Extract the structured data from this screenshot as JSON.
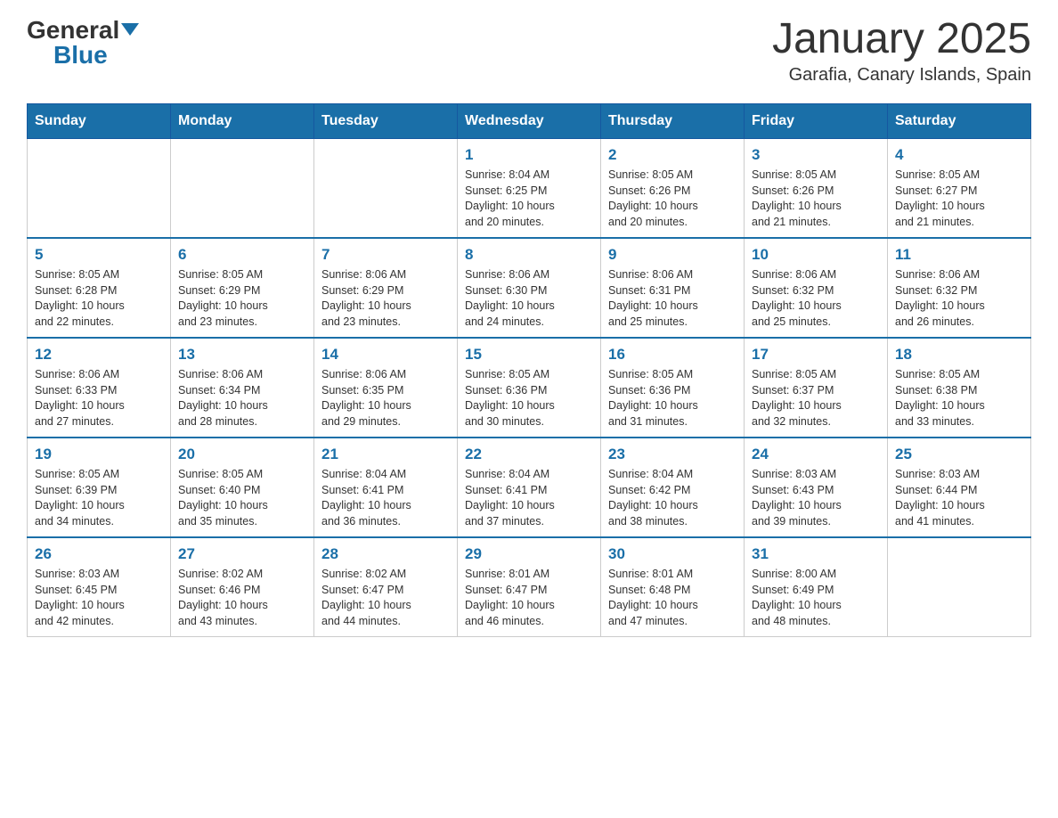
{
  "header": {
    "logo_general": "General",
    "logo_blue": "Blue",
    "month_title": "January 2025",
    "location": "Garafia, Canary Islands, Spain"
  },
  "days_of_week": [
    "Sunday",
    "Monday",
    "Tuesday",
    "Wednesday",
    "Thursday",
    "Friday",
    "Saturday"
  ],
  "weeks": [
    [
      {
        "day": "",
        "info": ""
      },
      {
        "day": "",
        "info": ""
      },
      {
        "day": "",
        "info": ""
      },
      {
        "day": "1",
        "info": "Sunrise: 8:04 AM\nSunset: 6:25 PM\nDaylight: 10 hours\nand 20 minutes."
      },
      {
        "day": "2",
        "info": "Sunrise: 8:05 AM\nSunset: 6:26 PM\nDaylight: 10 hours\nand 20 minutes."
      },
      {
        "day": "3",
        "info": "Sunrise: 8:05 AM\nSunset: 6:26 PM\nDaylight: 10 hours\nand 21 minutes."
      },
      {
        "day": "4",
        "info": "Sunrise: 8:05 AM\nSunset: 6:27 PM\nDaylight: 10 hours\nand 21 minutes."
      }
    ],
    [
      {
        "day": "5",
        "info": "Sunrise: 8:05 AM\nSunset: 6:28 PM\nDaylight: 10 hours\nand 22 minutes."
      },
      {
        "day": "6",
        "info": "Sunrise: 8:05 AM\nSunset: 6:29 PM\nDaylight: 10 hours\nand 23 minutes."
      },
      {
        "day": "7",
        "info": "Sunrise: 8:06 AM\nSunset: 6:29 PM\nDaylight: 10 hours\nand 23 minutes."
      },
      {
        "day": "8",
        "info": "Sunrise: 8:06 AM\nSunset: 6:30 PM\nDaylight: 10 hours\nand 24 minutes."
      },
      {
        "day": "9",
        "info": "Sunrise: 8:06 AM\nSunset: 6:31 PM\nDaylight: 10 hours\nand 25 minutes."
      },
      {
        "day": "10",
        "info": "Sunrise: 8:06 AM\nSunset: 6:32 PM\nDaylight: 10 hours\nand 25 minutes."
      },
      {
        "day": "11",
        "info": "Sunrise: 8:06 AM\nSunset: 6:32 PM\nDaylight: 10 hours\nand 26 minutes."
      }
    ],
    [
      {
        "day": "12",
        "info": "Sunrise: 8:06 AM\nSunset: 6:33 PM\nDaylight: 10 hours\nand 27 minutes."
      },
      {
        "day": "13",
        "info": "Sunrise: 8:06 AM\nSunset: 6:34 PM\nDaylight: 10 hours\nand 28 minutes."
      },
      {
        "day": "14",
        "info": "Sunrise: 8:06 AM\nSunset: 6:35 PM\nDaylight: 10 hours\nand 29 minutes."
      },
      {
        "day": "15",
        "info": "Sunrise: 8:05 AM\nSunset: 6:36 PM\nDaylight: 10 hours\nand 30 minutes."
      },
      {
        "day": "16",
        "info": "Sunrise: 8:05 AM\nSunset: 6:36 PM\nDaylight: 10 hours\nand 31 minutes."
      },
      {
        "day": "17",
        "info": "Sunrise: 8:05 AM\nSunset: 6:37 PM\nDaylight: 10 hours\nand 32 minutes."
      },
      {
        "day": "18",
        "info": "Sunrise: 8:05 AM\nSunset: 6:38 PM\nDaylight: 10 hours\nand 33 minutes."
      }
    ],
    [
      {
        "day": "19",
        "info": "Sunrise: 8:05 AM\nSunset: 6:39 PM\nDaylight: 10 hours\nand 34 minutes."
      },
      {
        "day": "20",
        "info": "Sunrise: 8:05 AM\nSunset: 6:40 PM\nDaylight: 10 hours\nand 35 minutes."
      },
      {
        "day": "21",
        "info": "Sunrise: 8:04 AM\nSunset: 6:41 PM\nDaylight: 10 hours\nand 36 minutes."
      },
      {
        "day": "22",
        "info": "Sunrise: 8:04 AM\nSunset: 6:41 PM\nDaylight: 10 hours\nand 37 minutes."
      },
      {
        "day": "23",
        "info": "Sunrise: 8:04 AM\nSunset: 6:42 PM\nDaylight: 10 hours\nand 38 minutes."
      },
      {
        "day": "24",
        "info": "Sunrise: 8:03 AM\nSunset: 6:43 PM\nDaylight: 10 hours\nand 39 minutes."
      },
      {
        "day": "25",
        "info": "Sunrise: 8:03 AM\nSunset: 6:44 PM\nDaylight: 10 hours\nand 41 minutes."
      }
    ],
    [
      {
        "day": "26",
        "info": "Sunrise: 8:03 AM\nSunset: 6:45 PM\nDaylight: 10 hours\nand 42 minutes."
      },
      {
        "day": "27",
        "info": "Sunrise: 8:02 AM\nSunset: 6:46 PM\nDaylight: 10 hours\nand 43 minutes."
      },
      {
        "day": "28",
        "info": "Sunrise: 8:02 AM\nSunset: 6:47 PM\nDaylight: 10 hours\nand 44 minutes."
      },
      {
        "day": "29",
        "info": "Sunrise: 8:01 AM\nSunset: 6:47 PM\nDaylight: 10 hours\nand 46 minutes."
      },
      {
        "day": "30",
        "info": "Sunrise: 8:01 AM\nSunset: 6:48 PM\nDaylight: 10 hours\nand 47 minutes."
      },
      {
        "day": "31",
        "info": "Sunrise: 8:00 AM\nSunset: 6:49 PM\nDaylight: 10 hours\nand 48 minutes."
      },
      {
        "day": "",
        "info": ""
      }
    ]
  ]
}
